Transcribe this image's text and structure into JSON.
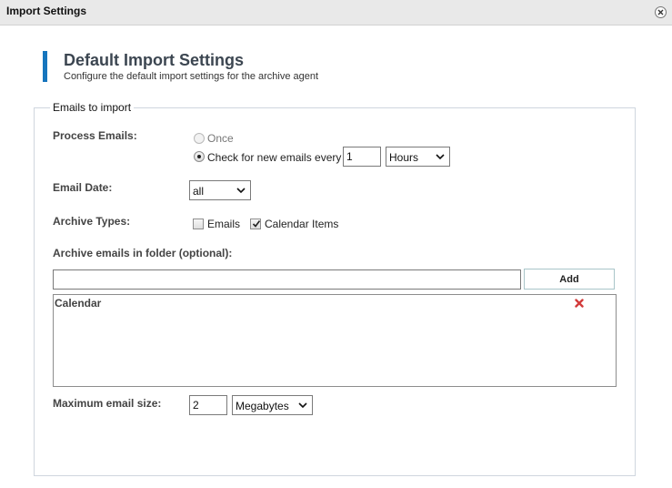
{
  "window": {
    "title": "Import Settings",
    "close_icon": "close-icon"
  },
  "header": {
    "title": "Default Import Settings",
    "subtitle": "Configure the default import settings for the archive agent",
    "accent_color": "#1675bd"
  },
  "group": {
    "legend": "Emails to import"
  },
  "process_emails": {
    "label": "Process Emails:",
    "option_once": "Once",
    "option_check": "Check for new emails every",
    "selected": "check",
    "interval_value": "1",
    "interval_unit": "Hours"
  },
  "email_date": {
    "label": "Email Date:",
    "value": "all"
  },
  "archive_types": {
    "label": "Archive Types:",
    "emails_label": "Emails",
    "emails_checked": false,
    "calendar_label": "Calendar Items",
    "calendar_checked": true
  },
  "archive_folder": {
    "label": "Archive emails in folder (optional):",
    "input_value": "",
    "add_label": "Add",
    "items": [
      {
        "label": "Calendar",
        "remove_icon": "remove-x-icon"
      }
    ]
  },
  "max_size": {
    "label": "Maximum email size:",
    "value": "2",
    "unit": "Megabytes"
  }
}
